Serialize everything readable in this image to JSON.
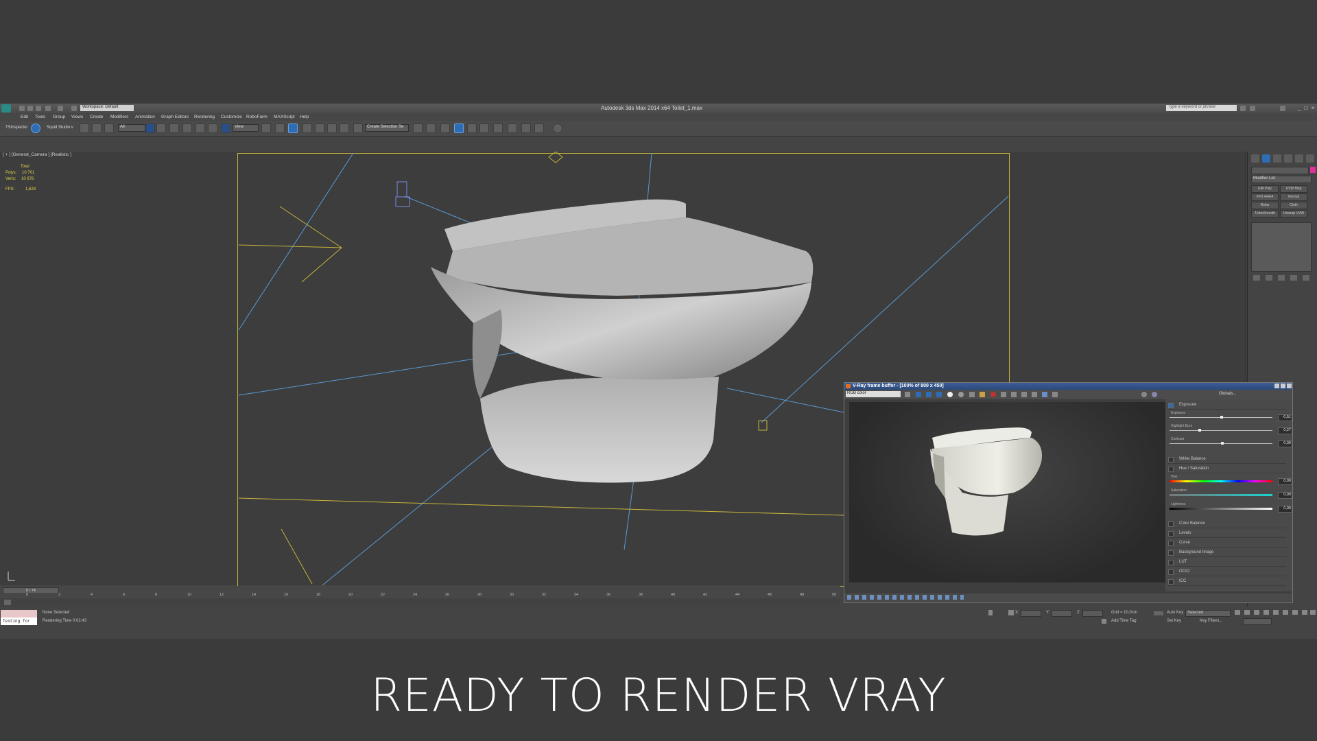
{
  "window": {
    "title": "Autodesk 3ds Max 2014 x64    Toilet_1.max",
    "workspace": "Workspace: Default",
    "search_placeholder": "Type a keyword or phrase"
  },
  "menu": [
    "Edit",
    "Tools",
    "Group",
    "Views",
    "Create",
    "Modifiers",
    "Animation",
    "Graph Editors",
    "Rendering",
    "Customize",
    "RoboFarm",
    "MAXScript",
    "Help"
  ],
  "toolbar": {
    "ts_label": "TSInspector",
    "squid_label": "Squid Studio v",
    "filter_value": "All",
    "refcoord_value": "View",
    "selection_set": "Create Selection Se"
  },
  "viewport": {
    "label": "[ + ] [General_Camera ] [Realistic ]",
    "stats": {
      "total_label": "Total",
      "polys_label": "Polys:",
      "polys_value": "10 701",
      "verts_label": "Verts:",
      "verts_value": "10 876",
      "fps_label": "FPS:",
      "fps_value": "1,628"
    }
  },
  "command_panel": {
    "modifier_list": "Modifier List",
    "buttons": [
      "Edit Poly",
      "UVW Map",
      "FFD 4x4x4",
      "Normal",
      "Relax",
      "Cloth",
      "TurboSmooth",
      "Unwrap UVW"
    ]
  },
  "timeline": {
    "frame_counter": "0 / 74",
    "ticks": [
      "0",
      "2",
      "4",
      "6",
      "8",
      "10",
      "12",
      "14",
      "16",
      "18",
      "20",
      "22",
      "24",
      "26",
      "28",
      "30",
      "32",
      "34",
      "36",
      "38",
      "40",
      "42",
      "44",
      "46",
      "48",
      "50"
    ]
  },
  "status": {
    "maxscript_input": "Testing for",
    "none_selected": "None Selected",
    "rendering_time": "Rendering Time  0:02:43",
    "x_label": "X:",
    "y_label": "Y:",
    "z_label": "Z:",
    "grid": "Grid = 10,0cm",
    "add_time_tag": "Add Time Tag",
    "auto_key": "Auto Key",
    "selected_dd": "Selected",
    "set_key": "Set Key",
    "key_filters": "Key Filters..."
  },
  "vfb": {
    "title": "V-Ray frame buffer - [100% of 800 x 450]",
    "channel": "RGB color",
    "globals": "Globals...",
    "exposure_title": "Exposure",
    "exposure_label": "Exposure",
    "exposure_value": "-0,51",
    "highlight_label": "Highlight Burn",
    "highlight_value": "0,27",
    "contrast_label": "Contrast",
    "contrast_value": "0,09",
    "white_balance": "White Balance",
    "hue_sat": "Hue / Saturation",
    "hue_label": "Hue",
    "hue_value": "0,00",
    "sat_label": "Saturation",
    "sat_value": "0,00",
    "light_label": "Lightness",
    "light_value": "0,00",
    "sections": [
      "Color Balance",
      "Levels",
      "Curve",
      "Background Image",
      "LUT",
      "OCIO",
      "ICC"
    ]
  },
  "caption": "READY TO RENDER VRAY"
}
